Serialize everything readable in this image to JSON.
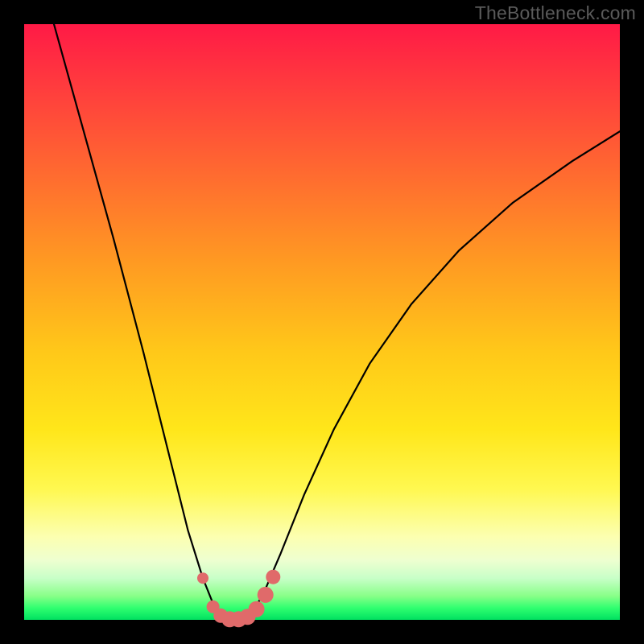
{
  "watermark": "TheBottleneck.com",
  "chart_data": {
    "type": "line",
    "title": "",
    "xlabel": "",
    "ylabel": "",
    "xlim": [
      0,
      1
    ],
    "ylim": [
      0,
      1
    ],
    "series": [
      {
        "name": "bottleneck-curve",
        "x": [
          0.05,
          0.1,
          0.15,
          0.2,
          0.25,
          0.275,
          0.3,
          0.32,
          0.335,
          0.35,
          0.365,
          0.38,
          0.4,
          0.43,
          0.47,
          0.52,
          0.58,
          0.65,
          0.73,
          0.82,
          0.92,
          1.0
        ],
        "y": [
          1.0,
          0.82,
          0.64,
          0.45,
          0.25,
          0.15,
          0.07,
          0.02,
          0.003,
          0.0,
          0.002,
          0.01,
          0.04,
          0.11,
          0.21,
          0.32,
          0.43,
          0.53,
          0.62,
          0.7,
          0.77,
          0.82
        ]
      }
    ],
    "markers": {
      "name": "highlight-dots",
      "color": "#e06a6a",
      "points": [
        {
          "x": 0.3,
          "y": 0.07,
          "r": 7
        },
        {
          "x": 0.317,
          "y": 0.022,
          "r": 8
        },
        {
          "x": 0.33,
          "y": 0.007,
          "r": 9
        },
        {
          "x": 0.345,
          "y": 0.001,
          "r": 10
        },
        {
          "x": 0.36,
          "y": 0.001,
          "r": 10
        },
        {
          "x": 0.375,
          "y": 0.005,
          "r": 10
        },
        {
          "x": 0.39,
          "y": 0.018,
          "r": 10
        },
        {
          "x": 0.405,
          "y": 0.042,
          "r": 10
        },
        {
          "x": 0.418,
          "y": 0.072,
          "r": 9
        }
      ]
    }
  }
}
